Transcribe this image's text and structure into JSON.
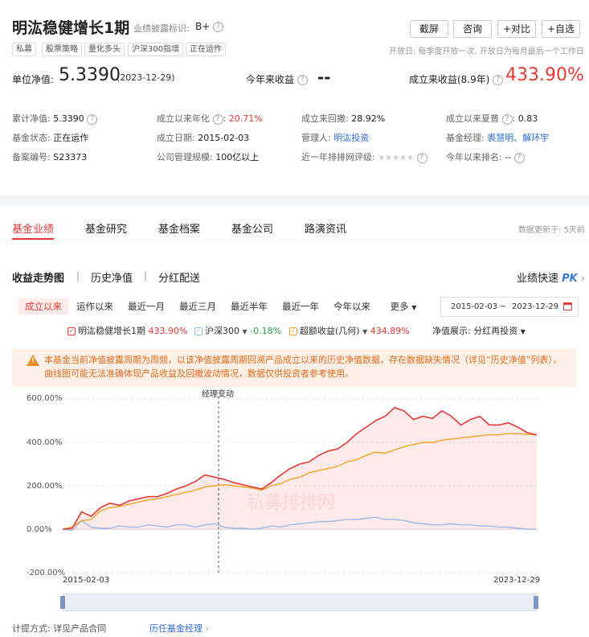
{
  "fund": {
    "name": "明汯稳健增长1期",
    "disclosure_label": "业绩披露标识:",
    "disclosure_value": "B+",
    "tags": [
      "私募",
      "股票策略",
      "量化多头",
      "沪深300指增",
      "正在运作"
    ],
    "open_info": "开放日: 每季度开放一次, 开放日为每月最后一个工作日"
  },
  "top_buttons": [
    "截屏",
    "咨询",
    "+对比",
    "+自选"
  ],
  "nav": {
    "label": "单位净值:",
    "value": "5.3390",
    "date": "(2023-12-29)",
    "ytd_label": "今年来收益",
    "ytd_value": "--",
    "since_label": "成立来收益(8.9年)",
    "since_value": "433.90%"
  },
  "details": {
    "cum_nav_label": "累计净值:",
    "cum_nav": "5.3390",
    "annual_label": "成立以来年化",
    "annual": "20.71%",
    "drawdown_label": "成立来回撤:",
    "drawdown": "28.92%",
    "sharpe_label": "成立以来夏普",
    "sharpe": "0.83",
    "status_label": "基金状态:",
    "status": "正在运作",
    "inception_label": "成立日期:",
    "inception": "2015-02-03",
    "manager_label": "管理人:",
    "manager": "明汯投资",
    "fund_manager_label": "基金经理:",
    "fund_manager": "裘慧明、解环宇",
    "record_label": "备案编号:",
    "record": "S23373",
    "scale_label": "公司管理规模:",
    "scale": "100亿以上",
    "rating_label": "近一年排排网评级:",
    "rating": "★★★★★",
    "rank_label": "今年以来排名:",
    "rank": "--"
  },
  "main_tabs": [
    "基金业绩",
    "基金研究",
    "基金档案",
    "基金公司",
    "路演资讯"
  ],
  "update_info": "数据更新于: 5天前",
  "sub_tabs": [
    "收益走势图",
    "历史净值",
    "分红配送"
  ],
  "pk_label": "业绩快速",
  "pk_mark": "PK",
  "ranges": [
    "成立以来",
    "运作以来",
    "最近一月",
    "最近三月",
    "最近半年",
    "最近一年",
    "今年以来",
    "更多"
  ],
  "date_range": {
    "start": "2015-02-03",
    "sep": "~",
    "end": "2023-12-29"
  },
  "legend": {
    "fund_name": "明汯稳健增长1期",
    "fund_value": "433.90%",
    "index_name": "沪深300",
    "index_value": "-0.18%",
    "excess_name": "超额收益(几何)",
    "excess_value": "434.89%",
    "nav_display_label": "净值展示:",
    "nav_display_value": "分红再投资"
  },
  "warning": "本基金当前净值披露周期为周频，以该净值披露周期回溯产品成立以来的历史净值数据，存在数据缺失情况（详见“历史净值”列表），曲线图可能无法准确体现产品收益及回撤波动情况，数据仅供投资者参考使用。",
  "watermark": "私募排排网",
  "chart_data": {
    "type": "line",
    "annotation": "经理变动",
    "x_start": "2015-02-03",
    "x_end": "2023-12-29",
    "y_ticks": [
      "600.00%",
      "400.00%",
      "200.00%",
      "0.00%",
      "-200.00%"
    ],
    "ylim": [
      -200,
      600
    ],
    "x": [
      0,
      0.02,
      0.04,
      0.06,
      0.08,
      0.1,
      0.12,
      0.14,
      0.16,
      0.18,
      0.2,
      0.22,
      0.24,
      0.26,
      0.28,
      0.3,
      0.32,
      0.34,
      0.36,
      0.38,
      0.4,
      0.42,
      0.44,
      0.46,
      0.48,
      0.5,
      0.52,
      0.54,
      0.56,
      0.58,
      0.6,
      0.62,
      0.64,
      0.66,
      0.68,
      0.7,
      0.72,
      0.74,
      0.76,
      0.78,
      0.8,
      0.82,
      0.84,
      0.86,
      0.88,
      0.9,
      0.92,
      0.94,
      0.96,
      0.98,
      1.0
    ],
    "series": [
      {
        "name": "明汯稳健增长1期",
        "color": "#e53935",
        "values": [
          0,
          5,
          80,
          60,
          100,
          120,
          110,
          130,
          140,
          150,
          150,
          165,
          185,
          200,
          220,
          250,
          240,
          230,
          215,
          205,
          195,
          185,
          215,
          250,
          280,
          300,
          310,
          340,
          360,
          370,
          400,
          440,
          470,
          500,
          520,
          560,
          545,
          505,
          520,
          510,
          545,
          520,
          480,
          505,
          520,
          480,
          480,
          490,
          470,
          445,
          433.9
        ]
      },
      {
        "name": "沪深300",
        "color": "#9bb8e6",
        "values": [
          0,
          -5,
          40,
          10,
          5,
          5,
          15,
          10,
          10,
          20,
          15,
          10,
          20,
          20,
          10,
          20,
          25,
          10,
          5,
          5,
          0,
          5,
          15,
          10,
          20,
          25,
          30,
          35,
          35,
          40,
          45,
          45,
          50,
          55,
          45,
          45,
          40,
          30,
          25,
          20,
          20,
          25,
          20,
          20,
          15,
          15,
          10,
          10,
          5,
          0,
          -0.18
        ]
      },
      {
        "name": "超额收益(几何)",
        "color": "#f5a623",
        "values": [
          0,
          10,
          40,
          45,
          85,
          100,
          105,
          115,
          125,
          135,
          140,
          150,
          160,
          170,
          180,
          195,
          200,
          205,
          200,
          195,
          190,
          180,
          200,
          210,
          230,
          240,
          260,
          270,
          280,
          290,
          310,
          320,
          340,
          355,
          350,
          365,
          380,
          390,
          400,
          400,
          410,
          415,
          420,
          425,
          430,
          435,
          435,
          440,
          440,
          437,
          434.89
        ]
      }
    ]
  },
  "plan_label": "计提方式: 详见产品合同",
  "history_manager_label": "历任基金经理"
}
